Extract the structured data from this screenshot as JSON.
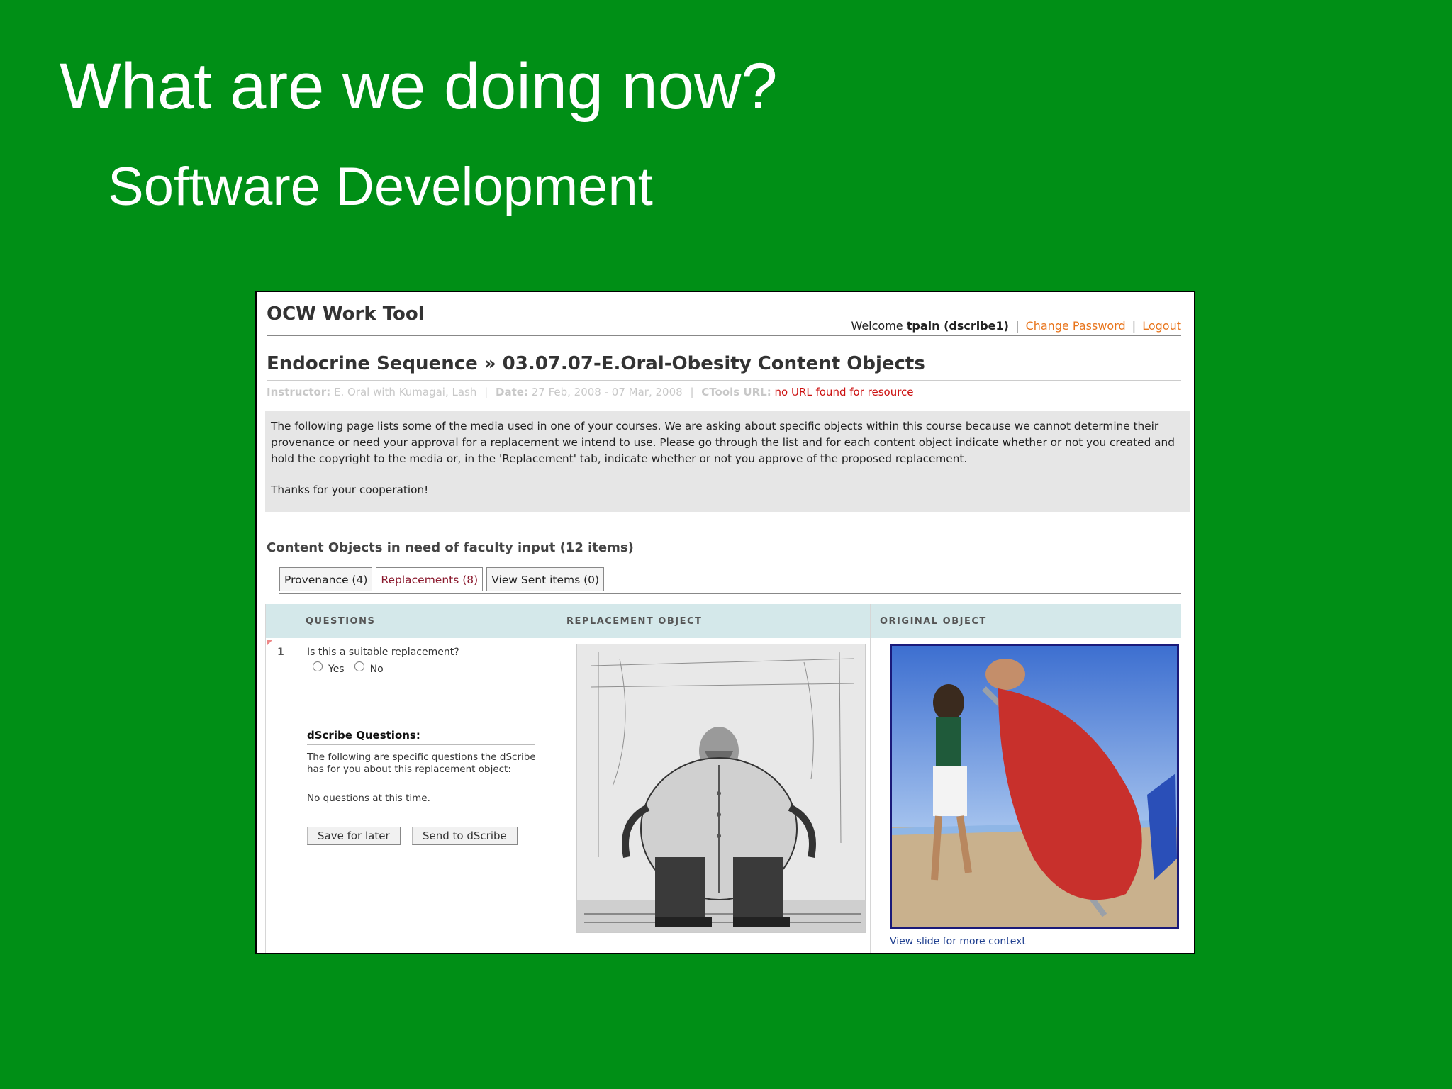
{
  "slide": {
    "title": "What are we doing now?",
    "subtitle": "Software Development"
  },
  "app": {
    "title": "OCW Work Tool",
    "welcome_label": "Welcome",
    "username": "tpain (dscribe1)",
    "change_password": "Change Password",
    "logout": "Logout",
    "separator": "|"
  },
  "page": {
    "title": "Endocrine Sequence » 03.07.07-E.Oral-Obesity Content Objects",
    "instructor_label": "Instructor:",
    "instructor_value": "E. Oral with Kumagai, Lash",
    "date_label": "Date:",
    "date_value": "27 Feb, 2008 - 07 Mar, 2008",
    "ctools_label": "CTools URL:",
    "ctools_value": "no URL found for resource"
  },
  "intro": {
    "paragraph1": "The following page lists some of the media used in one of your courses. We are asking about specific objects within this course because we cannot determine their provenance or need your approval for a replacement we intend to use. Please go through the list and for each content object indicate whether or not you created and hold the copyright to the media or, in the 'Replacement' tab, indicate whether or not you approve of the proposed replacement.",
    "paragraph2": "Thanks for your cooperation!"
  },
  "section": {
    "title": "Content Objects in need of faculty input (12 items)"
  },
  "tabs": [
    {
      "label": "Provenance (4)",
      "active": false
    },
    {
      "label": "Replacements (8)",
      "active": true
    },
    {
      "label": "View Sent items (0)",
      "active": false
    }
  ],
  "table": {
    "headers": [
      "QUESTIONS",
      "REPLACEMENT OBJECT",
      "ORIGINAL OBJECT"
    ],
    "row": {
      "number": "1",
      "question": "Is this a suitable replacement?",
      "option_yes": "Yes",
      "option_no": "No",
      "dscribe_title": "dScribe Questions:",
      "dscribe_desc": "The following are specific questions the dScribe has for you about this replacement object:",
      "dscribe_none": "No questions at this time.",
      "save_button": "Save for later",
      "send_button": "Send to dScribe",
      "original_link": "View slide for more context"
    }
  },
  "colors": {
    "slide_bg": "#008f16",
    "link_orange": "#e8741b",
    "error_red": "#cc1111",
    "active_tab": "#8b1a2e",
    "table_header": "#d4e8ea"
  }
}
